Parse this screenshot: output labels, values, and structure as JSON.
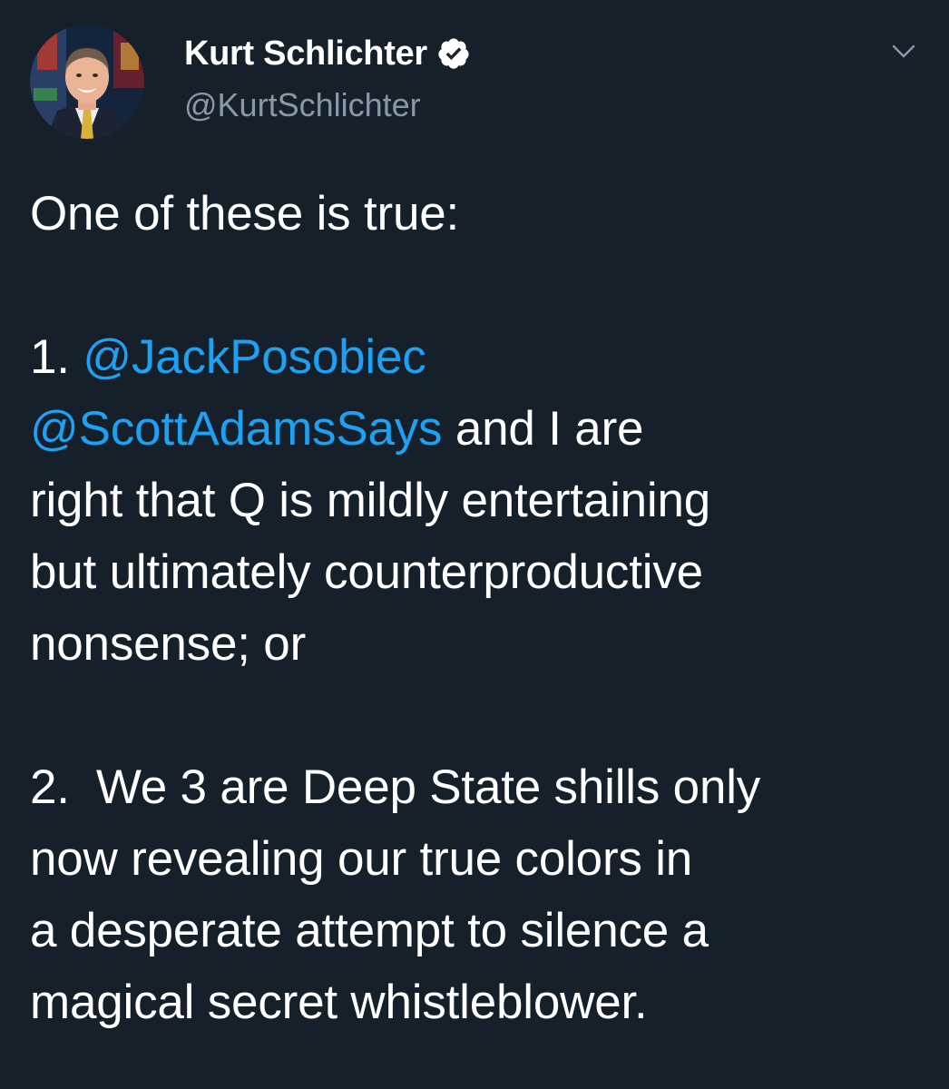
{
  "user": {
    "display_name": "Kurt Schlichter",
    "handle": "@KurtSchlichter",
    "verified": true
  },
  "tweet": {
    "intro": "One of these is true:",
    "item1_number": "1.",
    "mention1": "@JackPosobiec",
    "mention2": "@ScottAdamsSays",
    "item1_line2_rest": " and I are",
    "item1_line3": "right that Q is mildly entertaining",
    "item1_line4": "but ultimately counterproductive",
    "item1_line5": "nonsense; or",
    "item2_line1": "2.  We 3 are Deep State shills only",
    "item2_line2": "now revealing our true colors in",
    "item2_line3": "a desperate attempt to silence a",
    "item2_line4": "magical secret whistleblower."
  },
  "colors": {
    "background": "#15202b",
    "text": "#ffffff",
    "secondary": "#8899a6",
    "link": "#1da1f2"
  },
  "icons": {
    "verified": "verified-badge-icon",
    "more": "chevron-down-icon"
  }
}
